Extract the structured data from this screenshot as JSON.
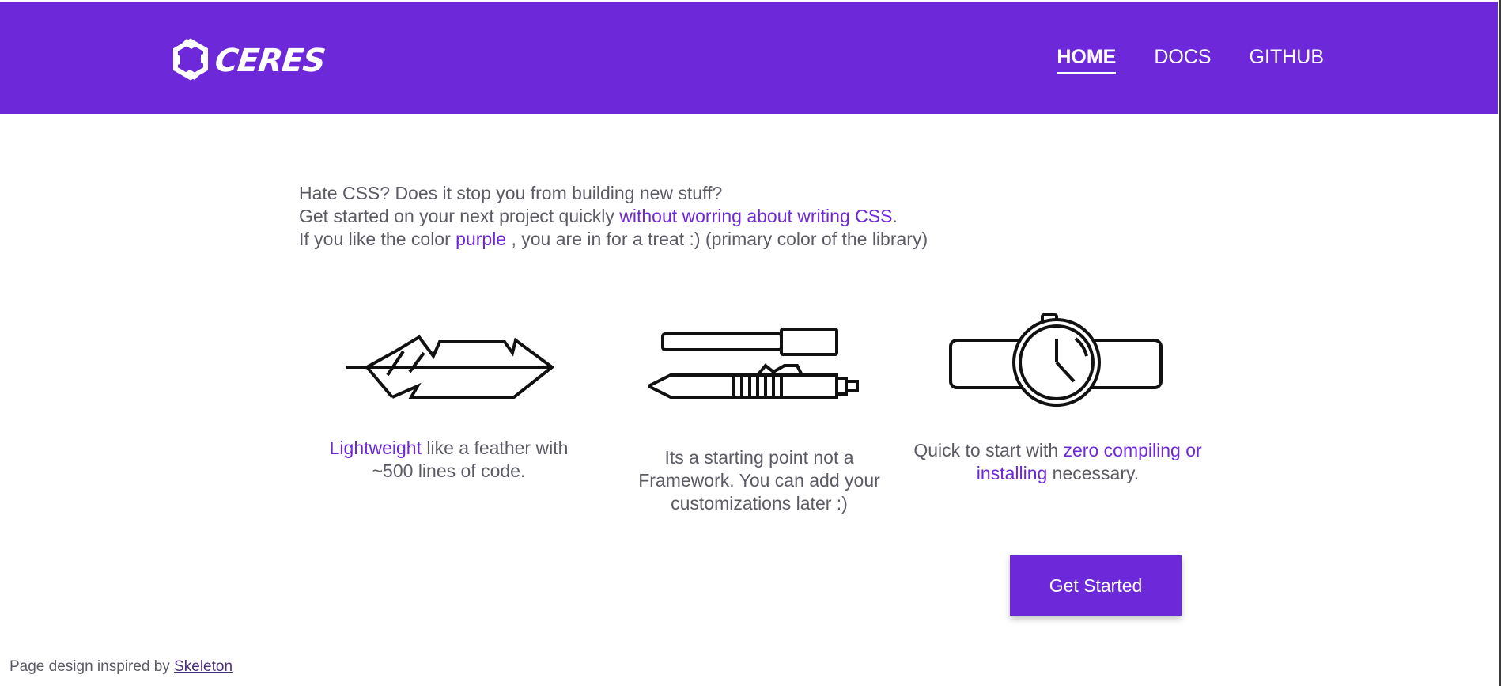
{
  "header": {
    "logo_text": "CERES",
    "nav": [
      {
        "label": "HOME",
        "active": true
      },
      {
        "label": "DOCS",
        "active": false
      },
      {
        "label": "GITHUB",
        "active": false
      }
    ]
  },
  "intro": {
    "line1": "Hate CSS? Does it stop you from building new stuff?",
    "line2_prefix": "Get started on your next project quickly ",
    "line2_accent": "without worring about writing CSS",
    "line2_suffix": ".",
    "line3_prefix": "If you like the color ",
    "line3_accent": "purple",
    "line3_suffix": " , you are in for a treat :) (primary color of the library)"
  },
  "features": [
    {
      "icon": "feather-icon",
      "accent": "Lightweight",
      "text_after": " like a feather with ~500 lines of code."
    },
    {
      "icon": "pens-icon",
      "text": "Its a starting point not a Framework. You can add your customizations later :)"
    },
    {
      "icon": "watch-icon",
      "text_before": "Quick to start with ",
      "accent": "zero compiling or installing",
      "text_after": " necessary."
    }
  ],
  "cta": {
    "label": "Get Started"
  },
  "footer": {
    "prefix": "Page design inspired by ",
    "link": "Skeleton"
  },
  "colors": {
    "primary": "#6d28d9",
    "text": "#5b5b66",
    "background": "#ffffff"
  }
}
